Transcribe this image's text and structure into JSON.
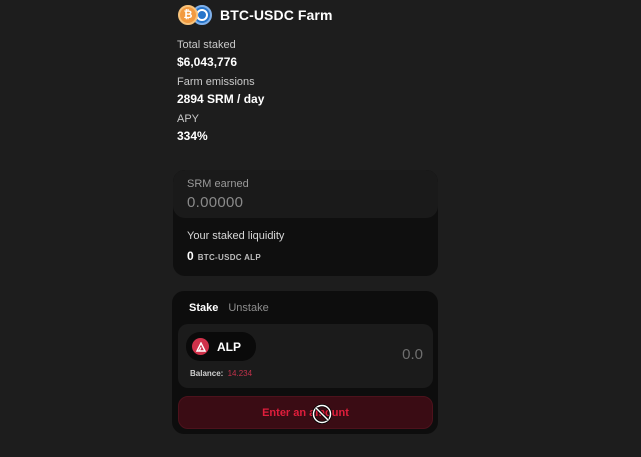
{
  "header": {
    "title": "BTC-USDC Farm",
    "tokens": [
      "btc-icon",
      "usdc-icon"
    ],
    "btc_glyph": "₿"
  },
  "stats": {
    "total_staked_label": "Total staked",
    "total_staked_value": "$6,043,776",
    "emissions_label": "Farm emissions",
    "emissions_value": "2894 SRM / day",
    "apy_label": "APY",
    "apy_value": "334%"
  },
  "earned": {
    "label": "SRM earned",
    "value": "0.00000",
    "liquidity_label": "Your staked liquidity",
    "liquidity_amount": "0",
    "liquidity_unit": "BTC-USDC ALP"
  },
  "stake": {
    "tabs": [
      {
        "label": "Stake",
        "active": true
      },
      {
        "label": "Unstake",
        "active": false
      }
    ],
    "token_label": "ALP",
    "balance_label": "Balance:",
    "balance_value": "14.234",
    "amount_placeholder": "0.0",
    "button_label": "Enter an amount"
  },
  "colors": {
    "background": "#1d1d1d",
    "accent": "#e01e3c",
    "btc": "#f29a3f",
    "usdc": "#2775ca"
  }
}
